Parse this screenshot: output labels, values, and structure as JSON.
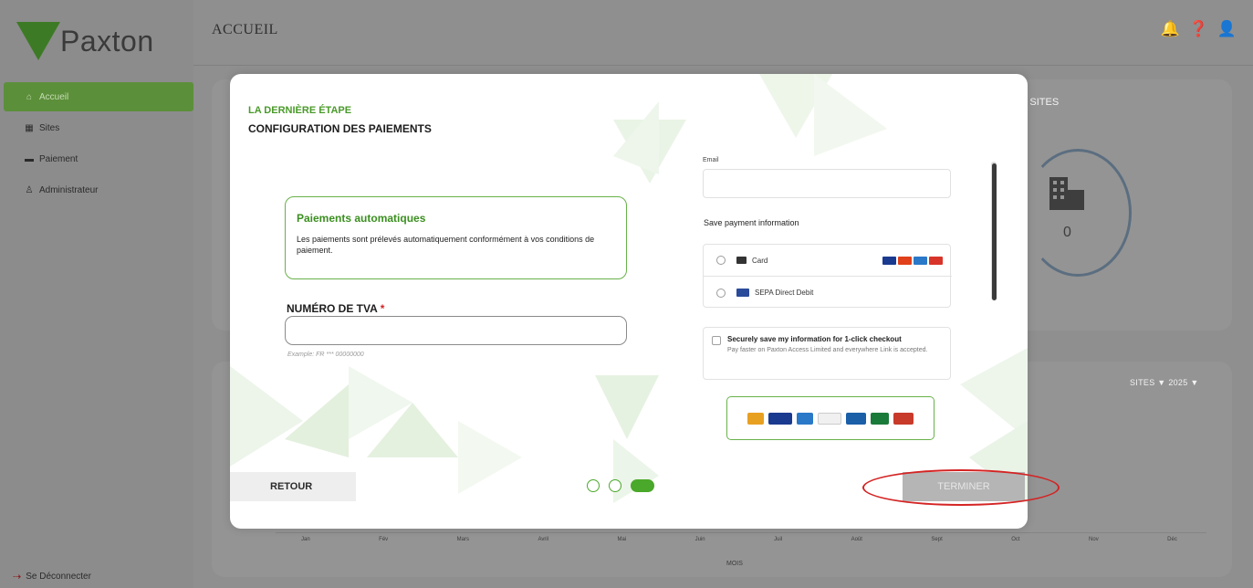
{
  "brand": {
    "name": "Paxton",
    "color": "#4a9a2a"
  },
  "sidebar": {
    "items": [
      {
        "label": "Accueil",
        "icon": "home-icon",
        "active": true
      },
      {
        "label": "Sites",
        "icon": "building-icon",
        "active": false
      },
      {
        "label": "Paiement",
        "icon": "payment-card-icon",
        "active": false
      },
      {
        "label": "Administrateur",
        "icon": "user-icon",
        "active": false
      }
    ],
    "logout": "Se Déconnecter"
  },
  "header": {
    "title": "ACCUEIL",
    "icons": [
      "bell-icon",
      "help-icon",
      "user-icon"
    ]
  },
  "dashboard": {
    "sites_label": "E SITES",
    "sites_count": "0",
    "filter": "SITES ▼  2025 ▼",
    "months": [
      "Jan",
      "Fév",
      "Mars",
      "Avril",
      "Mai",
      "Juin",
      "Juil",
      "Août",
      "Sept",
      "Oct",
      "Nov",
      "Déc"
    ],
    "x_axis": "MOIS"
  },
  "modal": {
    "step_label": "LA DERNIÈRE ÉTAPE",
    "step_title": "CONFIGURATION DES PAIEMENTS",
    "auto": {
      "title": "Paiements automatiques",
      "desc": "Les paiements sont prélevés automatiquement conformément à vos conditions de paiement."
    },
    "tva": {
      "label": "NUMÉRO DE TVA",
      "required": "*",
      "value": "",
      "hint": "Example: FR *** 00000000"
    },
    "stripe": {
      "email_label": "Email",
      "email_value": "",
      "save_title": "Save payment information",
      "options": [
        "Card",
        "SEPA Direct Debit"
      ],
      "link_title": "Securely save my information for 1-click checkout",
      "link_desc": "Pay faster on Paxton Access Limited and everywhere Link is accepted."
    },
    "back_button": "RETOUR",
    "finish_button": "TERMINER",
    "steps": {
      "total": 3,
      "current": 3
    }
  },
  "colors": {
    "accent_green": "#4a9a2a",
    "annotation_red": "#d42424"
  }
}
